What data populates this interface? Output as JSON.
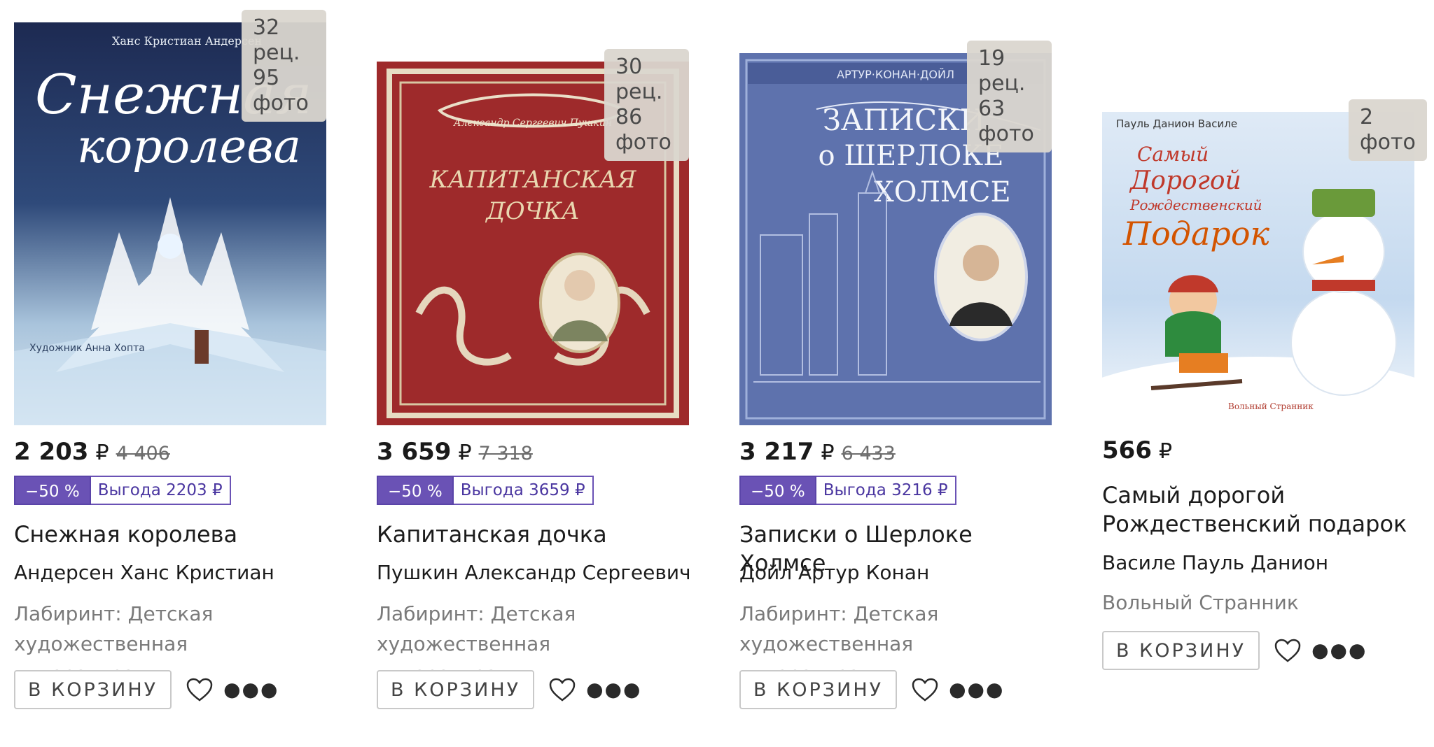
{
  "cart_label": "В КОРЗИНУ",
  "currency": "₽",
  "books": [
    {
      "badge": "32 рец.\n95 фото",
      "price": "2 203",
      "old_price": "4 406",
      "discount": "−50 %",
      "savings": "Выгода 2203 ₽",
      "title": "Снежная королева",
      "author": "Андерсен Ханс Кристиан",
      "publisher": "Лабиринт: Детская художественная литература",
      "cover_author": "Ханс Кристиан Андерсен",
      "cover_title_1": "Снежная",
      "cover_title_2": "королева",
      "cover_illustrator": "Художник Анна Хопта"
    },
    {
      "badge": "30 рец.\n86 фото",
      "price": "3 659",
      "old_price": "7 318",
      "discount": "−50 %",
      "savings": "Выгода 3659 ₽",
      "title": "Капитанская дочка",
      "author": "Пушкин Александр Сергеевич",
      "publisher": "Лабиринт: Детская художественная литература",
      "cover_author": "Александр Сергеевич Пушкин",
      "cover_title_1": "КАПИТАНСКАЯ",
      "cover_title_2": "ДОЧКА"
    },
    {
      "badge": "19 рец.\n63 фото",
      "price": "3 217",
      "old_price": "6 433",
      "discount": "−50 %",
      "savings": "Выгода 3216 ₽",
      "title": "Записки о Шерлоке Холмсе",
      "author": "Дойл Артур Конан",
      "publisher": "Лабиринт: Детская художественная литература",
      "cover_author": "АРТУР·КОНАН·ДОЙЛ",
      "cover_title_1": "ЗАПИСКИ",
      "cover_title_2": "о ШЕРЛОКЕ",
      "cover_title_3": "ХОЛМСЕ"
    },
    {
      "badge": "2 фото",
      "price": "566",
      "title": "Самый дорогой Рождественский подарок",
      "author": "Василе Пауль Данион",
      "publisher": "Вольный Странник",
      "cover_author": "Пауль Данион Василе",
      "cover_title_1": "Самый",
      "cover_title_2": "Дорогой",
      "cover_title_3": "Рождественский",
      "cover_title_4": "Подарок",
      "cover_publisher": "Вольный Странник"
    }
  ]
}
